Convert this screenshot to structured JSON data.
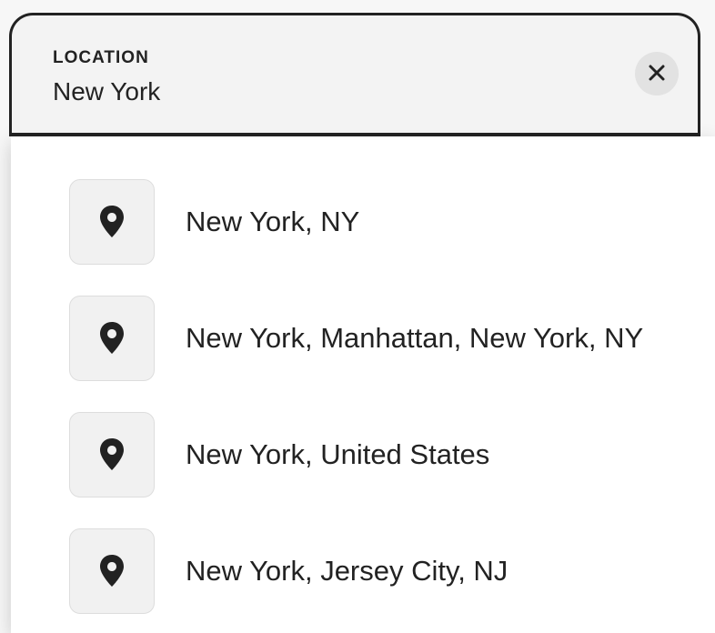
{
  "location": {
    "label": "LOCATION",
    "value": "New York",
    "clear_icon": "close-icon"
  },
  "suggestions": [
    {
      "icon": "map-pin-icon",
      "label": "New York, NY"
    },
    {
      "icon": "map-pin-icon",
      "label": "New York, Manhattan, New York, NY"
    },
    {
      "icon": "map-pin-icon",
      "label": "New York, United States"
    },
    {
      "icon": "map-pin-icon",
      "label": "New York, Jersey City, NJ"
    }
  ]
}
